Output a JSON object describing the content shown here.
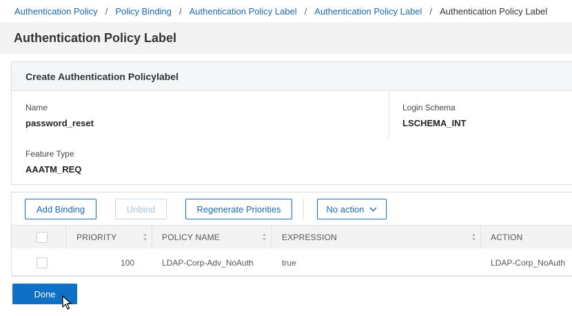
{
  "breadcrumb": {
    "items": [
      "Authentication Policy",
      "Policy Binding",
      "Authentication Policy Label",
      "Authentication Policy Label"
    ],
    "current": "Authentication Policy Label",
    "separator": "/"
  },
  "page": {
    "title": "Authentication Policy Label"
  },
  "details": {
    "header": "Create Authentication Policylabel",
    "name_label": "Name",
    "name_value": "password_reset",
    "login_schema_label": "Login Schema",
    "login_schema_value": "LSCHEMA_INT",
    "feature_type_label": "Feature Type",
    "feature_type_value": "AAATM_REQ"
  },
  "toolbar": {
    "add_binding": "Add Binding",
    "unbind": "Unbind",
    "regenerate": "Regenerate Priorities",
    "action_select": "No action"
  },
  "table": {
    "columns": [
      "PRIORITY",
      "POLICY NAME",
      "EXPRESSION",
      "ACTION"
    ],
    "rows": [
      {
        "priority": "100",
        "policy_name": "LDAP-Corp-Adv_NoAuth",
        "expression": "true",
        "action": "LDAP-Corp_NoAuth"
      }
    ]
  },
  "footer": {
    "done": "Done"
  },
  "colors": {
    "link": "#1a6ab3",
    "primary": "#0f71c6",
    "title_bg": "#f3f3f3"
  }
}
